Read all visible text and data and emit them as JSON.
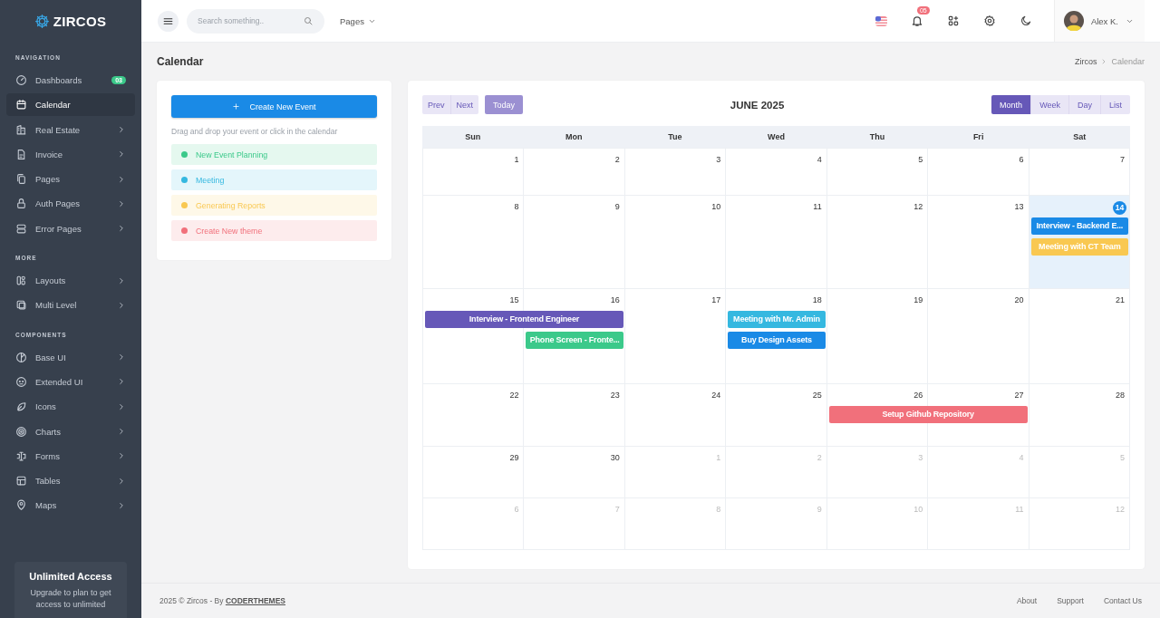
{
  "brand": {
    "name": "ZIRCOS"
  },
  "sidebar": {
    "sections": [
      {
        "title": "NAVIGATION",
        "items": [
          {
            "label": "Dashboards",
            "badge": "03",
            "has_children": false,
            "selected": false
          },
          {
            "label": "Calendar",
            "has_children": false,
            "selected": true
          },
          {
            "label": "Real Estate",
            "has_children": true,
            "selected": false
          },
          {
            "label": "Invoice",
            "has_children": true,
            "selected": false
          },
          {
            "label": "Pages",
            "has_children": true,
            "selected": false
          },
          {
            "label": "Auth Pages",
            "has_children": true,
            "selected": false
          },
          {
            "label": "Error Pages",
            "has_children": true,
            "selected": false
          }
        ]
      },
      {
        "title": "MORE",
        "items": [
          {
            "label": "Layouts",
            "has_children": true,
            "selected": false
          },
          {
            "label": "Multi Level",
            "has_children": true,
            "selected": false
          }
        ]
      },
      {
        "title": "COMPONENTS",
        "items": [
          {
            "label": "Base UI",
            "has_children": true,
            "selected": false
          },
          {
            "label": "Extended UI",
            "has_children": true,
            "selected": false
          },
          {
            "label": "Icons",
            "has_children": true,
            "selected": false
          },
          {
            "label": "Charts",
            "has_children": true,
            "selected": false
          },
          {
            "label": "Forms",
            "has_children": true,
            "selected": false
          },
          {
            "label": "Tables",
            "has_children": true,
            "selected": false
          },
          {
            "label": "Maps",
            "has_children": true,
            "selected": false
          }
        ]
      }
    ]
  },
  "promo_card": {
    "title": "Unlimited Access",
    "text": "Upgrade to plan to get access to unlimited"
  },
  "topbar": {
    "search": {
      "placeholder": "Search something.."
    },
    "pages_menu": "Pages",
    "notification_count": "05",
    "user": "Alex K."
  },
  "page_header": {
    "title": "Calendar",
    "breadcrumb": [
      "Zircos",
      "Calendar"
    ]
  },
  "events_panel": {
    "create_button": "Create New Event",
    "hint": "Drag and drop your event or click in the calendar",
    "events": [
      {
        "label": "New Event Planning",
        "color": "#3bc98a"
      },
      {
        "label": "Meeting",
        "color": "#35b8e0"
      },
      {
        "label": "Generating Reports",
        "color": "#f9c851"
      },
      {
        "label": "Create New theme",
        "color": "#f1707b"
      }
    ]
  },
  "calendar": {
    "nav": [
      "Prev",
      "Next"
    ],
    "today_button": "Today",
    "title": "JUNE 2025",
    "views": [
      {
        "label": "Month",
        "selected": true
      },
      {
        "label": "Week",
        "selected": false
      },
      {
        "label": "Day",
        "selected": false
      },
      {
        "label": "List",
        "selected": false
      }
    ],
    "weekdays": [
      "Sun",
      "Mon",
      "Tue",
      "Wed",
      "Thu",
      "Fri",
      "Sat"
    ],
    "weeks": [
      {
        "days": [
          {
            "day": "1",
            "other_month": false,
            "today": false
          },
          {
            "day": "2",
            "other_month": false,
            "today": false
          },
          {
            "day": "3",
            "other_month": false,
            "today": false
          },
          {
            "day": "4",
            "other_month": false,
            "today": false
          },
          {
            "day": "5",
            "other_month": false,
            "today": false
          },
          {
            "day": "6",
            "other_month": false,
            "today": false
          },
          {
            "day": "7",
            "other_month": false,
            "today": false
          }
        ]
      },
      {
        "days": [
          {
            "day": "8",
            "other_month": false,
            "today": false
          },
          {
            "day": "9",
            "other_month": false,
            "today": false
          },
          {
            "day": "10",
            "other_month": false,
            "today": false
          },
          {
            "day": "11",
            "other_month": false,
            "today": false
          },
          {
            "day": "12",
            "other_month": false,
            "today": false
          },
          {
            "day": "13",
            "other_month": false,
            "today": false
          },
          {
            "day": "14",
            "other_month": false,
            "today": true,
            "events": [
              {
                "title": "Interview - Backend E...",
                "color": "#1a8ae6"
              },
              {
                "title": "Meeting with CT Team",
                "color": "#f9c851"
              }
            ]
          }
        ]
      },
      {
        "days": [
          {
            "day": "15",
            "other_month": false,
            "today": false,
            "events": [
              {
                "title": "Interview - Frontend Engineer",
                "color": "#6658b8",
                "through_next_day": true
              }
            ]
          },
          {
            "day": "16",
            "other_month": false,
            "today": false,
            "events": [
              {
                "title": "Phone Screen - Fronte...",
                "color": "#3bc98a"
              }
            ]
          },
          {
            "day": "17",
            "other_month": false,
            "today": false
          },
          {
            "day": "18",
            "other_month": false,
            "today": false,
            "events": [
              {
                "title": "Meeting with Mr. Admin",
                "color": "#35b8e0"
              },
              {
                "title": "Buy Design Assets",
                "color": "#1a8ae6"
              }
            ]
          },
          {
            "day": "19",
            "other_month": false,
            "today": false
          },
          {
            "day": "20",
            "other_month": false,
            "today": false
          },
          {
            "day": "21",
            "other_month": false,
            "today": false
          }
        ]
      },
      {
        "days": [
          {
            "day": "22",
            "other_month": false,
            "today": false
          },
          {
            "day": "23",
            "other_month": false,
            "today": false
          },
          {
            "day": "24",
            "other_month": false,
            "today": false
          },
          {
            "day": "25",
            "other_month": false,
            "today": false
          },
          {
            "day": "26",
            "other_month": false,
            "today": false,
            "events": [
              {
                "title": "Setup Github Repository",
                "color": "#f1707b",
                "through_next_day": true
              }
            ]
          },
          {
            "day": "27",
            "other_month": false,
            "today": false
          },
          {
            "day": "28",
            "other_month": false,
            "today": false
          }
        ]
      },
      {
        "days": [
          {
            "day": "29",
            "other_month": false,
            "today": false
          },
          {
            "day": "30",
            "other_month": false,
            "today": false
          },
          {
            "day": "1",
            "other_month": true,
            "today": false
          },
          {
            "day": "2",
            "other_month": true,
            "today": false
          },
          {
            "day": "3",
            "other_month": true,
            "today": false
          },
          {
            "day": "4",
            "other_month": true,
            "today": false
          },
          {
            "day": "5",
            "other_month": true,
            "today": false
          }
        ]
      },
      {
        "days": [
          {
            "day": "6",
            "other_month": true,
            "today": false
          },
          {
            "day": "7",
            "other_month": true,
            "today": false
          },
          {
            "day": "8",
            "other_month": true,
            "today": false
          },
          {
            "day": "9",
            "other_month": true,
            "today": false
          },
          {
            "day": "10",
            "other_month": true,
            "today": false
          },
          {
            "day": "11",
            "other_month": true,
            "today": false
          },
          {
            "day": "12",
            "other_month": true,
            "today": false
          }
        ]
      }
    ]
  },
  "footer": {
    "copyright": "2025 © Zircos - By **CODERTHEMES**",
    "links": [
      "About",
      "Support",
      "Contact Us"
    ]
  }
}
